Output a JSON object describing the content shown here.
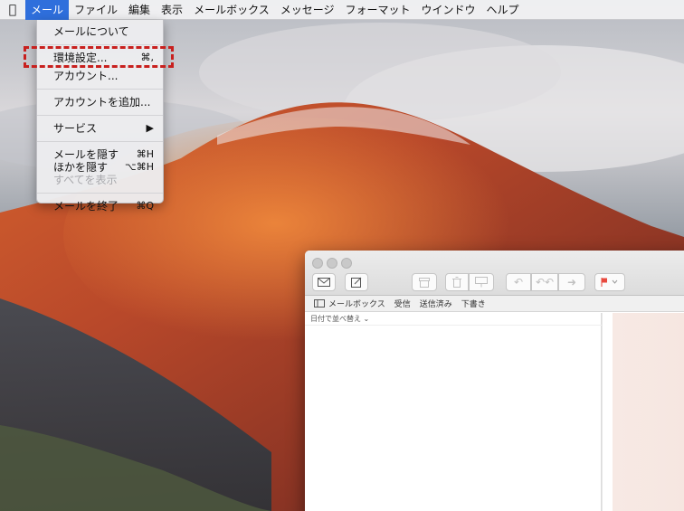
{
  "menubar": {
    "apple_icon": "apple-logo-icon",
    "items": [
      "メール",
      "ファイル",
      "編集",
      "表示",
      "メールボックス",
      "メッセージ",
      "フォーマット",
      "ウインドウ",
      "ヘルプ"
    ],
    "active_item": "メール"
  },
  "mail_menu": {
    "about": "メールについて",
    "preferences": "環境設定...",
    "preferences_shortcut": "⌘,",
    "accounts": "アカウント...",
    "add_account": "アカウントを追加...",
    "services": "サービス",
    "services_arrow": "▶",
    "hide_mail": "メールを隠す",
    "hide_mail_shortcut": "⌘H",
    "hide_others": "ほかを隠す",
    "hide_others_shortcut": "⌥⌘H",
    "show_all": "すべてを表示",
    "quit": "メールを終了",
    "quit_shortcut": "⌘Q"
  },
  "annotation": {
    "highlight_color": "#c8201e",
    "highlighted_item": "環境設定..."
  },
  "mail_window": {
    "toolbar_icons": [
      "get-mail-icon",
      "compose-icon",
      "archive-icon",
      "trash-icon",
      "junk-icon",
      "reply-icon",
      "reply-all-icon",
      "forward-icon",
      "flag-icon"
    ],
    "favorites": {
      "mailboxes": "メールボックス",
      "inbox": "受信",
      "sent": "送信済み",
      "drafts": "下書き"
    },
    "sort_label": "日付で並べ替え ⌄"
  },
  "colors": {
    "menu_highlight": "#2f6fdc",
    "flag": "#e8493e"
  }
}
